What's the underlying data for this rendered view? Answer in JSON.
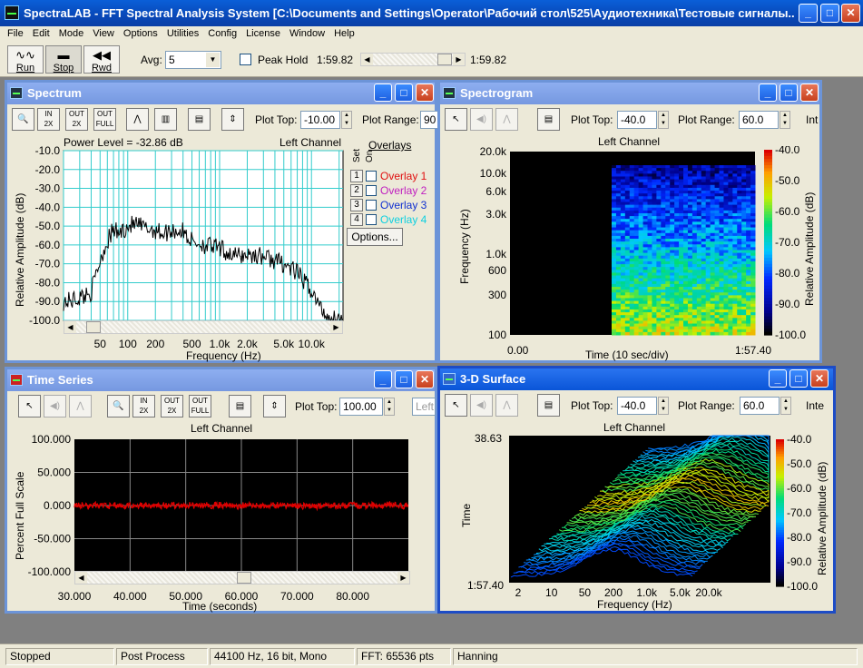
{
  "app": {
    "title": "SpectraLAB - FFT Spectral Analysis System [C:\\Documents and Settings\\Operator\\Рабочий стол\\525\\Аудиотехника\\Тестовые сигналы..."
  },
  "menu": [
    "File",
    "Edit",
    "Mode",
    "View",
    "Options",
    "Utilities",
    "Config",
    "License",
    "Window",
    "Help"
  ],
  "toolbar": {
    "run_label": "Run",
    "stop_label": "Stop",
    "rwd_label": "Rwd",
    "avg_label": "Avg:",
    "avg_value": "5",
    "peak_hold_label": "Peak Hold",
    "time_left": "1:59.82",
    "time_right": "1:59.82"
  },
  "spectrum": {
    "title": "Spectrum",
    "plot_top_label": "Plot Top:",
    "plot_top_value": "-10.00",
    "plot_range_label": "Plot Range:",
    "plot_range_value": "90",
    "power_level": "Power Level = -32.86 dB",
    "channel": "Left Channel",
    "ylabel": "Relative Amplitude (dB)",
    "xlabel": "Frequency (Hz)",
    "yticks": [
      "-10.0",
      "-20.0",
      "-30.0",
      "-40.0",
      "-50.0",
      "-60.0",
      "-70.0",
      "-80.0",
      "-90.0",
      "-100.0"
    ],
    "xticks": [
      "50",
      "100",
      "200",
      "500",
      "1.0k",
      "2.0k",
      "5.0k",
      "10.0k"
    ],
    "overlays_title": "Overlays",
    "set_label": "Set",
    "on_label": "On",
    "overlays": [
      {
        "num": "1",
        "name": "Overlay 1",
        "color": "#e01010"
      },
      {
        "num": "2",
        "name": "Overlay 2",
        "color": "#c020c0"
      },
      {
        "num": "3",
        "name": "Overlay 3",
        "color": "#1030d0"
      },
      {
        "num": "4",
        "name": "Overlay 4",
        "color": "#10d0e0"
      }
    ],
    "options_label": "Options...",
    "grid_color": "#33cccc",
    "chart_data": {
      "type": "line",
      "xlabel": "Frequency (Hz)",
      "ylabel": "Relative Amplitude (dB)",
      "x_scale": "log",
      "xlim": [
        20,
        22050
      ],
      "ylim": [
        -100,
        -10
      ],
      "x": [
        22,
        30,
        40,
        50,
        60,
        70,
        80,
        100,
        120,
        150,
        200,
        250,
        300,
        400,
        500,
        700,
        1000,
        1500,
        2000,
        3000,
        5000,
        7000,
        10000,
        12000,
        15000,
        20000
      ],
      "y": [
        -90,
        -88,
        -85,
        -68,
        -58,
        -52,
        -54,
        -50,
        -49,
        -51,
        -52,
        -54,
        -52,
        -53,
        -58,
        -60,
        -62,
        -66,
        -65,
        -66,
        -70,
        -75,
        -84,
        -92,
        -98,
        -100
      ]
    }
  },
  "spectrogram": {
    "title": "Spectrogram",
    "plot_top_label": "Plot Top:",
    "plot_top_value": "-40.0",
    "plot_range_label": "Plot Range:",
    "plot_range_value": "60.0",
    "int_label": "Int",
    "channel": "Left Channel",
    "ylabel": "Frequency (Hz)",
    "xlabel": "Time (10 sec/div)",
    "x_start": "0.00",
    "x_end": "1:57.40",
    "yticks": [
      "20.0k",
      "10.0k",
      "6.0k",
      "3.0k",
      "1.0k",
      "600",
      "300",
      "100"
    ],
    "colorbar_label": "Relative Amplitude (dB)",
    "cbticks": [
      "-40.0",
      "-50.0",
      "-60.0",
      "-70.0",
      "-80.0",
      "-90.0",
      "-100.0"
    ]
  },
  "time_series": {
    "title": "Time Series",
    "plot_top_label": "Plot Top:",
    "plot_top_value": "100.00",
    "left_label": "Left",
    "channel": "Left Channel",
    "ylabel": "Percent Full Scale",
    "xlabel": "Time (seconds)",
    "yticks": [
      "100.000",
      "50.000",
      "0.000",
      "-50.000",
      "-100.000"
    ],
    "xticks": [
      "30.000",
      "40.000",
      "50.000",
      "60.000",
      "70.000",
      "80.000"
    ],
    "chart_data": {
      "type": "line",
      "xlabel": "Time (seconds)",
      "ylabel": "Percent Full Scale",
      "xlim": [
        30,
        90
      ],
      "ylim": [
        -100,
        100
      ],
      "series": [
        {
          "color": "#e00000",
          "amplitude": 5
        }
      ]
    }
  },
  "surface": {
    "title": "3-D Surface",
    "plot_top_label": "Plot Top:",
    "plot_top_value": "-40.0",
    "plot_range_label": "Plot Range:",
    "plot_range_value": "60.0",
    "int_label": "Inte",
    "channel": "Left Channel",
    "ylabel": "Time",
    "xlabel": "Frequency (Hz)",
    "y_top": "38.63",
    "y_bottom": "1:57.40",
    "xticks": [
      "2",
      "10",
      "50",
      "200",
      "1.0k",
      "5.0k",
      "20.0k"
    ],
    "colorbar_label": "Relative Amplitude (dB)",
    "cbticks": [
      "-40.0",
      "-50.0",
      "-60.0",
      "-70.0",
      "-80.0",
      "-90.0",
      "-100.0"
    ]
  },
  "status": {
    "state": "Stopped",
    "mode": "Post Process",
    "format": "44100 Hz, 16 bit, Mono",
    "fft": "FFT: 65536 pts",
    "window": "Hanning"
  }
}
